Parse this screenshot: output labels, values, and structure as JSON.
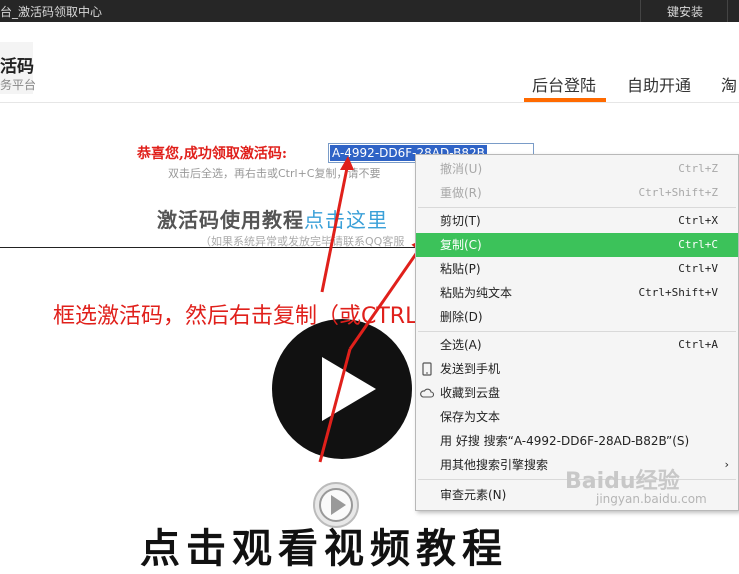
{
  "topbar": {
    "title": "台_激活码领取中心",
    "install": "键安装"
  },
  "logo": {
    "name": "活码",
    "sub": "务平台"
  },
  "nav": {
    "items": [
      {
        "label": "后台登陆"
      },
      {
        "label": "自助开通"
      },
      {
        "label": "淘"
      }
    ]
  },
  "content": {
    "congrats": "恭喜您,成功领取激活码:",
    "code": "A-4992-DD6F-28AD-B82B",
    "hint": "双击后全选，再右击或Ctrl+C复制，请不要",
    "tutorial_title_dark": "激活码使用教程",
    "tutorial_title_blue": "点击这里",
    "tutorial_sub": "（如果系统异常或发放完毕请联系QQ客服",
    "annotation": "框选激活码，然后右击复制（或CTRL+C键复制）",
    "bottom_text": "点击观看视频教程"
  },
  "context_menu": {
    "items": [
      {
        "label": "撤消(U)",
        "shortcut": "Ctrl+Z",
        "disabled": true
      },
      {
        "label": "重做(R)",
        "shortcut": "Ctrl+Shift+Z",
        "disabled": true
      },
      {
        "label": "剪切(T)",
        "shortcut": "Ctrl+X"
      },
      {
        "label": "复制(C)",
        "shortcut": "Ctrl+C",
        "highlighted": true
      },
      {
        "label": "粘贴(P)",
        "shortcut": "Ctrl+V"
      },
      {
        "label": "粘贴为纯文本",
        "shortcut": "Ctrl+Shift+V"
      },
      {
        "label": "删除(D)",
        "shortcut": ""
      },
      {
        "label": "全选(A)",
        "shortcut": "Ctrl+A"
      },
      {
        "label": "发送到手机",
        "icon": "phone-icon"
      },
      {
        "label": "收藏到云盘",
        "icon": "cloud-icon"
      },
      {
        "label": "保存为文本"
      },
      {
        "label": "用 好搜 搜索“A-4992-DD6F-28AD-B82B”(S)"
      },
      {
        "label": "用其他搜索引擎搜索",
        "submenu": true
      },
      {
        "label": "审查元素(N)"
      }
    ]
  },
  "watermark": {
    "main": "Baidu经验",
    "sub": "jingyan.baidu.com"
  },
  "colors": {
    "accent": "#ff6a00",
    "highlight": "#3cc25a",
    "annotation": "#e0201b"
  }
}
